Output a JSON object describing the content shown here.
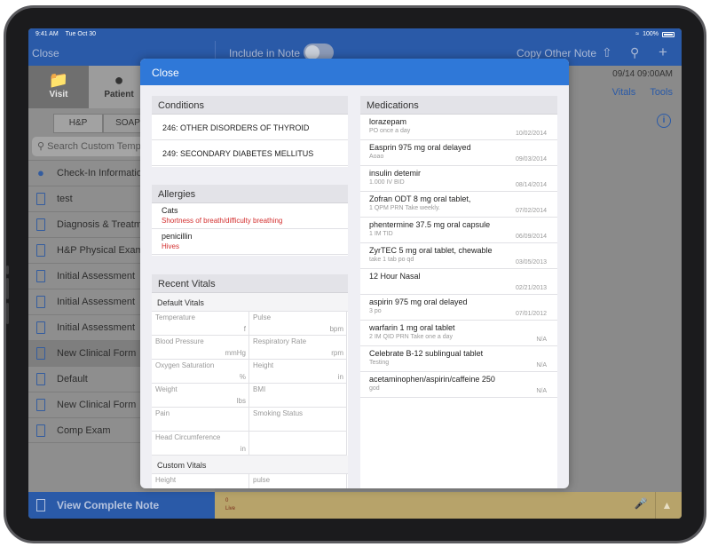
{
  "status_bar": {
    "time": "9:41 AM",
    "date": "Tue Oct 30",
    "battery": "100%"
  },
  "nav": {
    "close": "Close",
    "include_in_note": "Include in Note",
    "copy_other_note": "Copy Other Note"
  },
  "left_pane": {
    "tiles": [
      {
        "label": "Visit",
        "icon": "folder-icon"
      },
      {
        "label": "Patient",
        "icon": "person-icon"
      }
    ],
    "segments": [
      "H&P",
      "SOAP"
    ],
    "search_placeholder": "Search Custom Templates",
    "items": [
      {
        "label": "Check-In Information",
        "icon": "location-pin-icon"
      },
      {
        "label": "test",
        "icon": "document-icon"
      },
      {
        "label": "Diagnosis & Treatment",
        "icon": "document-icon"
      },
      {
        "label": "H&P Physical Exam",
        "icon": "document-icon"
      },
      {
        "label": "Initial Assessment",
        "icon": "document-icon"
      },
      {
        "label": "Initial Assessment",
        "icon": "document-icon"
      },
      {
        "label": "Initial Assessment",
        "icon": "document-icon"
      },
      {
        "label": "New Clinical Form",
        "icon": "document-icon",
        "selected": true
      },
      {
        "label": "Default",
        "icon": "document-icon"
      },
      {
        "label": "New Clinical Form",
        "icon": "document-icon"
      },
      {
        "label": "Comp Exam",
        "icon": "document-icon"
      }
    ]
  },
  "right_pane": {
    "datetime": "09/14 09:00AM",
    "vitals": "Vitals",
    "tools": "Tools"
  },
  "bottom": {
    "view_complete_note": "View Complete Note",
    "live_top": "0",
    "live_bottom": "Live"
  },
  "modal": {
    "close": "Close",
    "conditions": {
      "title": "Conditions",
      "items": [
        "246: OTHER DISORDERS OF THYROID",
        "249: SECONDARY DIABETES MELLITUS"
      ]
    },
    "allergies": {
      "title": "Allergies",
      "items": [
        {
          "name": "Cats",
          "reaction": "Shortness of breath/difficulty breathing"
        },
        {
          "name": "penicillin",
          "reaction": "Hives"
        }
      ]
    },
    "vitals": {
      "title": "Recent Vitals",
      "default_group": "Default Vitals",
      "cells": [
        {
          "label": "Temperature",
          "unit": "f"
        },
        {
          "label": "Pulse",
          "unit": "bpm"
        },
        {
          "label": "Blood Pressure",
          "unit": "mmHg"
        },
        {
          "label": "Respiratory Rate",
          "unit": "rpm"
        },
        {
          "label": "Oxygen Saturation",
          "unit": "%"
        },
        {
          "label": "Height",
          "unit": "in"
        },
        {
          "label": "Weight",
          "unit": "lbs"
        },
        {
          "label": "BMI",
          "unit": ""
        },
        {
          "label": "Pain",
          "unit": ""
        },
        {
          "label": "Smoking Status",
          "unit": ""
        },
        {
          "label": "Head Circumference",
          "unit": "in"
        }
      ],
      "custom_group": "Custom Vitals",
      "custom_cells": [
        {
          "label": "Height",
          "unit": ""
        },
        {
          "label": "pulse",
          "unit": ""
        }
      ]
    },
    "medications": {
      "title": "Medications",
      "items": [
        {
          "name": "lorazepam",
          "sig": "PO once a day",
          "date": "10/02/2014"
        },
        {
          "name": "Easprin 975 mg oral delayed",
          "sig": "Aoao",
          "date": "09/03/2014"
        },
        {
          "name": "insulin detemir",
          "sig": "1.000  IV BID",
          "date": "08/14/2014"
        },
        {
          "name": "Zofran ODT 8 mg oral tablet,",
          "sig": "1   QPM PRN Take weekly.",
          "date": "07/02/2014"
        },
        {
          "name": "phentermine 37.5 mg oral capsule",
          "sig": "1  IM TID",
          "date": "06/09/2014"
        },
        {
          "name": "ZyrTEC 5 mg oral tablet, chewable",
          "sig": "take 1 tab po qd",
          "date": "03/05/2013"
        },
        {
          "name": "12 Hour Nasal",
          "sig": "",
          "date": "02/21/2013"
        },
        {
          "name": "aspirin 975 mg oral delayed",
          "sig": "3 po",
          "date": "07/01/2012"
        },
        {
          "name": "warfarin 1 mg oral tablet",
          "sig": "2  IM QID PRN Take one a day",
          "date": "N/A"
        },
        {
          "name": "Celebrate B-12 sublingual tablet",
          "sig": "Testing",
          "date": "N/A"
        },
        {
          "name": "acetaminophen/aspirin/caffeine 250",
          "sig": "god",
          "date": "N/A"
        }
      ]
    }
  },
  "colors": {
    "nav_blue": "#2a5aa8",
    "modal_header": "#2f78d8",
    "reaction_red": "#d32f2f"
  }
}
